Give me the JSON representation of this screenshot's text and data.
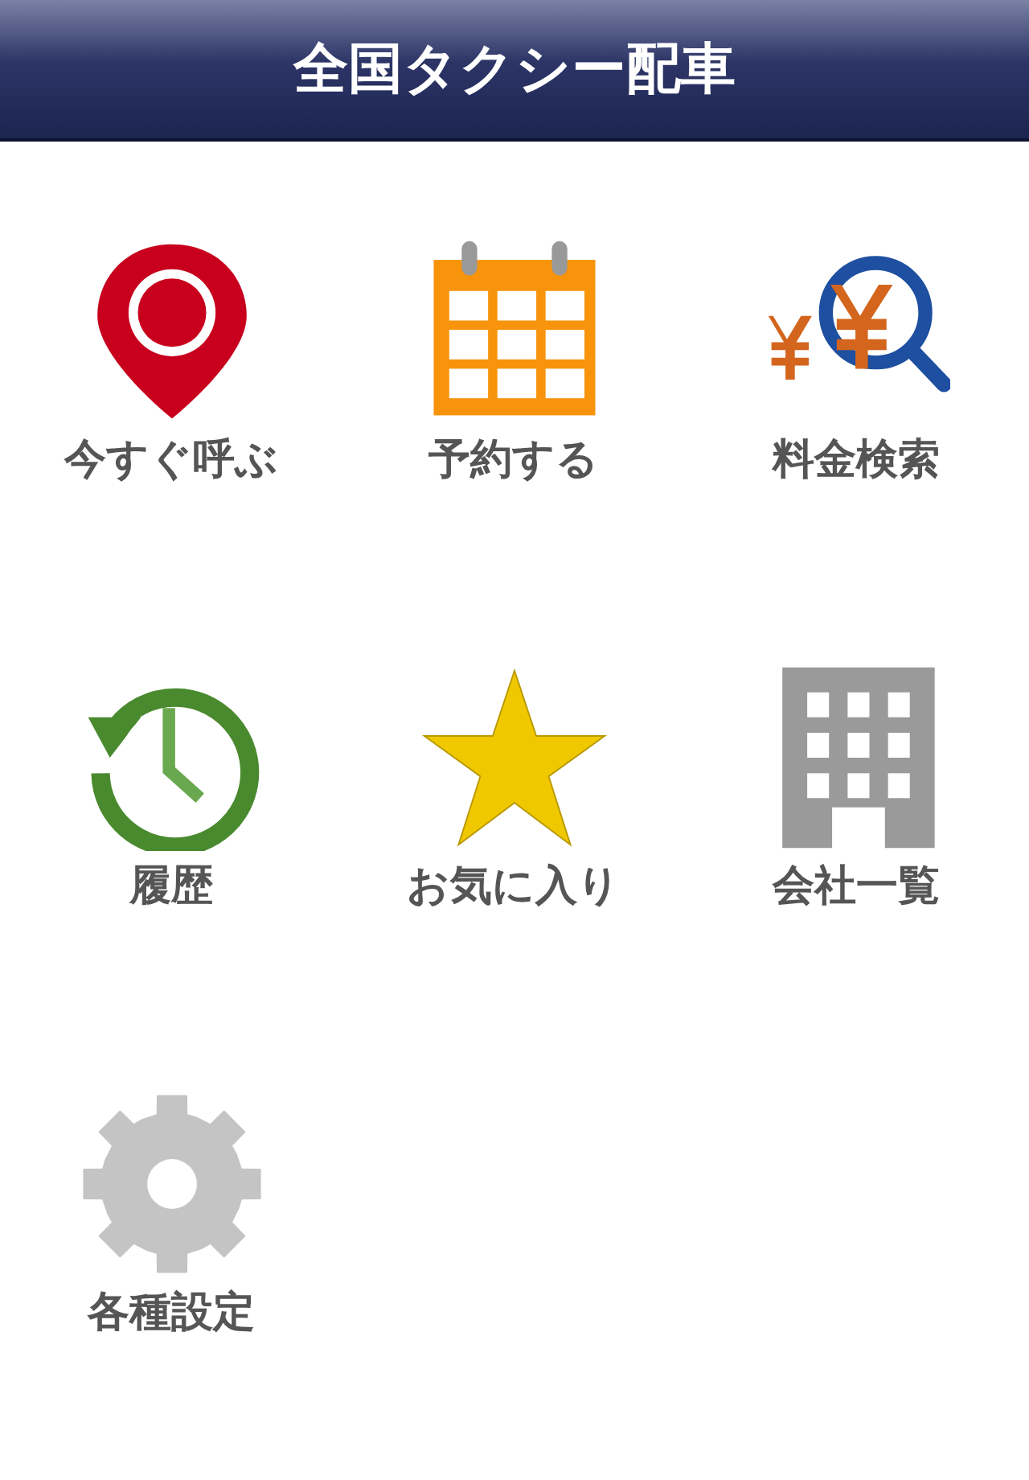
{
  "header": {
    "title": "全国タクシー配車"
  },
  "menu": [
    {
      "kind": "pin",
      "label": "今すぐ呼ぶ"
    },
    {
      "kind": "calendar",
      "label": "予約する"
    },
    {
      "kind": "fare",
      "label": "料金検索"
    },
    {
      "kind": "history",
      "label": "履歴"
    },
    {
      "kind": "star",
      "label": "お気に入り"
    },
    {
      "kind": "building",
      "label": "会社一覧"
    },
    {
      "kind": "gear",
      "label": "各種設定"
    }
  ]
}
